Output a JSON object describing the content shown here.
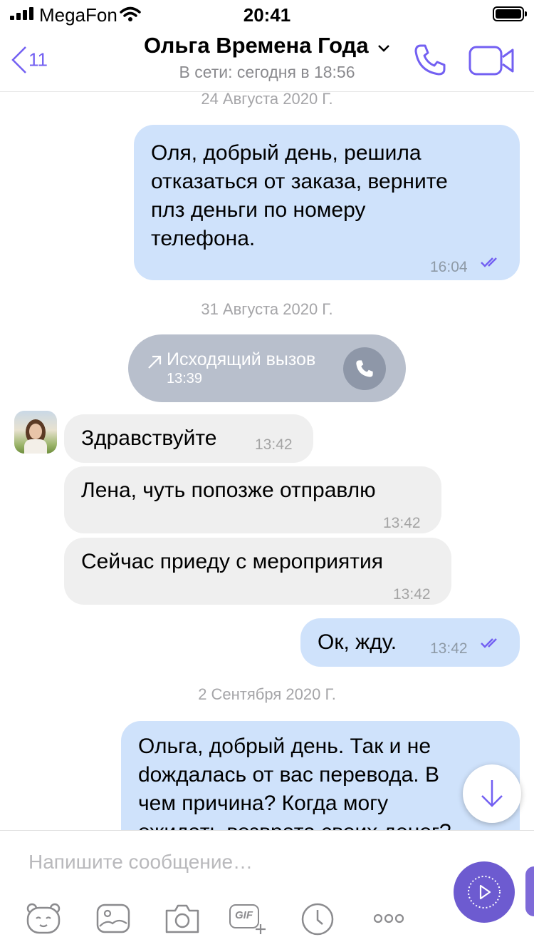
{
  "status_bar": {
    "carrier": "MegaFon",
    "time": "20:41"
  },
  "header": {
    "back_count": "11",
    "title": "Ольга Времена Года",
    "status": "В сети: сегодня в 18:56",
    "accent": "#7360f2"
  },
  "dates": [
    "24 Августа 2020 Г.",
    "31 Августа 2020 Г.",
    "2 Сентября 2020 Г."
  ],
  "messages": [
    {
      "dir": "out",
      "text": "Оля, добрый день, решила\nотказаться от заказа, верните\nплз деньги по номеру\nтелефона.",
      "time": "16:04",
      "status": "read"
    },
    {
      "dir": "call",
      "text": "Исходящий вызов",
      "time": "13:39"
    },
    {
      "dir": "in",
      "text": "Здравствуйте",
      "time": "13:42"
    },
    {
      "dir": "in",
      "text": "Лена, чуть попозже отправлю",
      "time": "13:42"
    },
    {
      "dir": "in",
      "text": "Сейчас приеду с мероприятия",
      "time": "13:42"
    },
    {
      "dir": "out",
      "text": "Ок, жду.",
      "time": "13:42",
      "status": "read"
    },
    {
      "dir": "out",
      "text": "Ольга, добрый день. Так и не\ndождалась от вас перевода. В\nчем причина? Когда могу\nожидать возврата своих денег?"
    }
  ],
  "composer": {
    "placeholder": "Напишите сообщение…"
  },
  "toolbar": {
    "gif_label": "GIF"
  },
  "colors": {
    "outgoing_bubble": "#cfe2fb",
    "incoming_bubble": "#efefef",
    "send_button": "#6d5bd0"
  }
}
